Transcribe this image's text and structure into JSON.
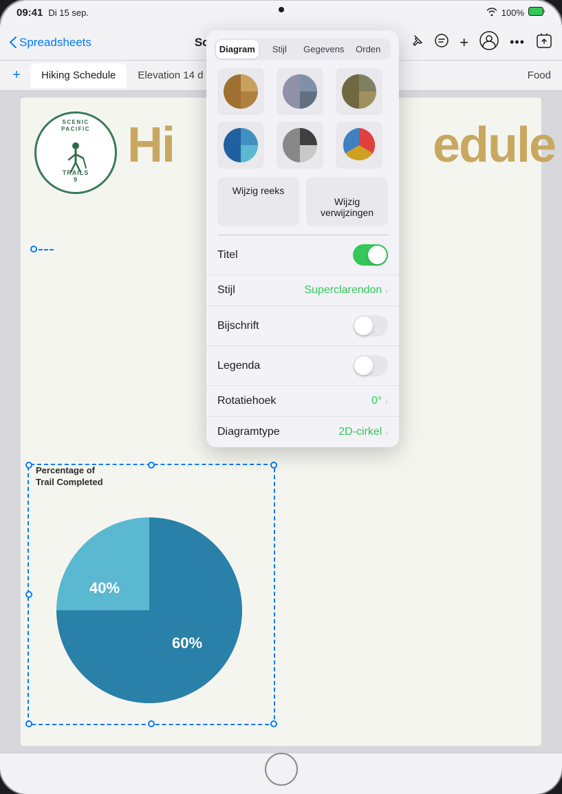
{
  "device": {
    "top_dot": true
  },
  "status_bar": {
    "time": "09:41",
    "date": "Di 15 sep.",
    "wifi": "WiFi",
    "battery": "100%"
  },
  "toolbar": {
    "back_label": "Spreadsheets",
    "title": "Scenic Pacific Trails",
    "pin_icon": "📌",
    "list_icon": "☰",
    "add_icon": "+",
    "avatar_icon": "👤",
    "more_icon": "•••",
    "share_icon": "⬆"
  },
  "sheet_tabs": {
    "add_label": "+",
    "tabs": [
      {
        "label": "Hiking Schedule",
        "active": true
      },
      {
        "label": "Elevation 14 d",
        "active": false
      },
      {
        "label": "Food",
        "active": false
      }
    ]
  },
  "chart": {
    "label_line1": "Percentage of",
    "label_line2": "Trail Completed",
    "slices": [
      {
        "pct": 40,
        "color": "#5ab8d0",
        "label": "40%"
      },
      {
        "pct": 60,
        "color": "#2980a8",
        "label": "60%"
      }
    ]
  },
  "panel": {
    "tabs": [
      {
        "label": "Diagram",
        "active": true
      },
      {
        "label": "Stijl",
        "active": false
      },
      {
        "label": "Gegevens",
        "active": false
      },
      {
        "label": "Orden",
        "active": false
      }
    ],
    "chart_styles": [
      {
        "id": "warm-pie-1",
        "selected": false,
        "colors": [
          "#c8a060",
          "#b08040",
          "#a07030"
        ]
      },
      {
        "id": "warm-pie-2",
        "selected": false,
        "colors": [
          "#8090a0",
          "#607080",
          "#9090a0"
        ]
      },
      {
        "id": "warm-pie-3",
        "selected": false,
        "colors": [
          "#808060",
          "#a09060",
          "#706840"
        ]
      },
      {
        "id": "blue-pie",
        "selected": false,
        "colors": [
          "#4090c0",
          "#2060a0",
          "#60b0d0"
        ]
      },
      {
        "id": "bw-pie",
        "selected": false,
        "colors": [
          "#404040",
          "#808080",
          "#c0c0c0"
        ]
      },
      {
        "id": "rainbow-pie",
        "selected": false,
        "colors": [
          "#e04040",
          "#4080c0",
          "#40a040",
          "#d0a020"
        ]
      }
    ],
    "buttons": [
      {
        "label": "Wijzig reeks",
        "id": "edit-series"
      },
      {
        "label": "Wijzig\nverwijzingen",
        "id": "edit-refs"
      }
    ],
    "rows": [
      {
        "label": "Titel",
        "type": "toggle",
        "state": "on",
        "value": null
      },
      {
        "label": "Stijl",
        "type": "value",
        "value": "Superclarendon",
        "chevron": true
      },
      {
        "label": "Bijschrift",
        "type": "toggle",
        "state": "off",
        "value": null
      },
      {
        "label": "Legenda",
        "type": "toggle",
        "state": "off",
        "value": null
      },
      {
        "label": "Rotatiehoek",
        "type": "value",
        "value": "0°",
        "chevron": true
      },
      {
        "label": "Diagramtype",
        "type": "value",
        "value": "2D-cirkel",
        "chevron": true
      }
    ]
  },
  "logo": {
    "scenic": "SCENIC",
    "pacific": "PACIFIC",
    "trails": "TRAILS",
    "number": "9"
  }
}
